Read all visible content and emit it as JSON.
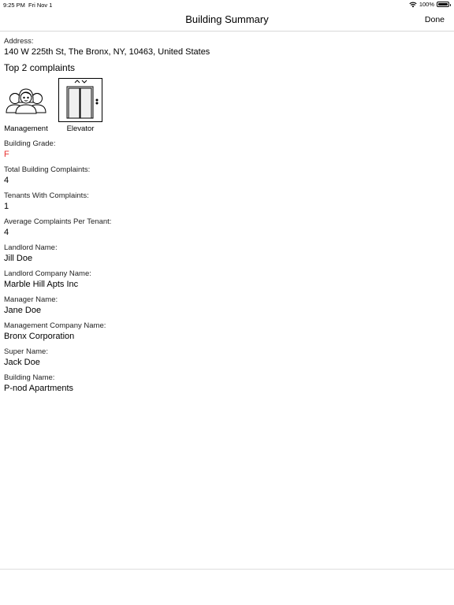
{
  "status_bar": {
    "time": "9:25 PM",
    "date": "Fri Nov 1",
    "battery": "100%",
    "battery_level": 1.0
  },
  "nav": {
    "title": "Building Summary",
    "done_label": "Done"
  },
  "address": {
    "label": "Address:",
    "value": "140 W 225th St, The Bronx, NY, 10463, United States"
  },
  "complaints": {
    "heading": "Top 2 complaints",
    "items": [
      {
        "label": "Management",
        "icon": "people-group-icon"
      },
      {
        "label": "Elevator",
        "icon": "elevator-icon"
      }
    ]
  },
  "fields": {
    "grade": {
      "label": "Building Grade:",
      "value": "F",
      "color": "#e8312f"
    },
    "total_complaints": {
      "label": "Total Building Complaints:",
      "value": "4"
    },
    "tenants_with_complaints": {
      "label": "Tenants With Complaints:",
      "value": "1"
    },
    "avg_complaints": {
      "label": "Average Complaints Per Tenant:",
      "value": "4"
    },
    "landlord_name": {
      "label": "Landlord Name:",
      "value": "Jill Doe"
    },
    "landlord_company": {
      "label": "Landlord Company Name:",
      "value": "Marble Hill Apts Inc"
    },
    "manager_name": {
      "label": "Manager Name:",
      "value": "Jane Doe"
    },
    "management_company": {
      "label": "Management Company Name:",
      "value": "Bronx Corporation"
    },
    "super_name": {
      "label": "Super Name:",
      "value": "Jack Doe"
    },
    "building_name": {
      "label": "Building Name:",
      "value": "P-nod Apartments"
    }
  }
}
